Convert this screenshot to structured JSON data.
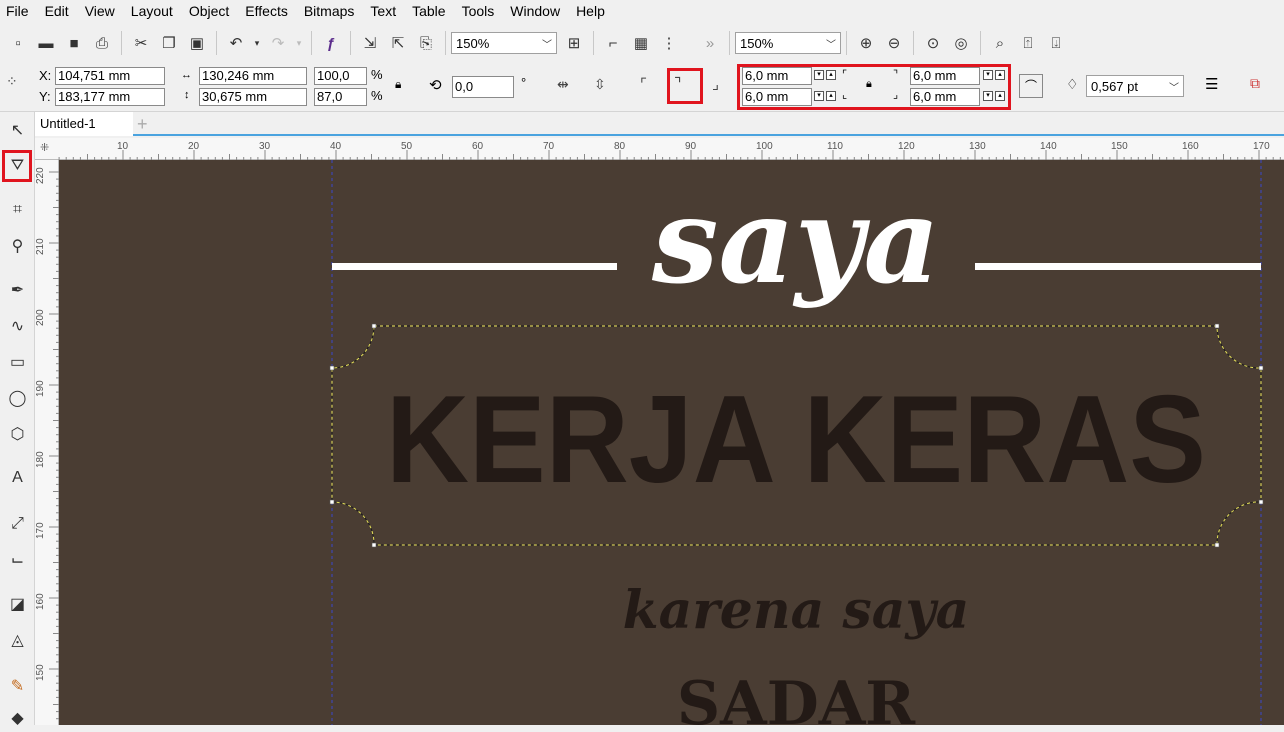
{
  "menu": [
    "File",
    "Edit",
    "View",
    "Layout",
    "Object",
    "Effects",
    "Bitmaps",
    "Text",
    "Table",
    "Tools",
    "Window",
    "Help"
  ],
  "toolbar": {
    "zoom_level_1": "150%",
    "zoom_level_2": "150%",
    "more": "»"
  },
  "props": {
    "x_label": "X:",
    "x_value": "104,751 mm",
    "y_label": "Y:",
    "y_value": "183,177 mm",
    "width_value": "130,246 mm",
    "height_value": "30,675 mm",
    "scale_x": "100,0",
    "scale_y": "87,0",
    "percent": "%",
    "rotation": "0,0",
    "degree": "°",
    "corner_tl": "6,0 mm",
    "corner_bl": "6,0 mm",
    "corner_tr": "6,0 mm",
    "corner_br": "6,0 mm",
    "outline_width": "0,567 pt"
  },
  "document": {
    "tab_title": "Untitled-1"
  },
  "ruler": {
    "h_ticks": [
      "10",
      "20",
      "30",
      "40",
      "50",
      "60",
      "70",
      "80",
      "90",
      "100",
      "110",
      "120",
      "130",
      "140",
      "150",
      "160",
      "170"
    ],
    "v_ticks": [
      "220",
      "210",
      "200",
      "190",
      "180",
      "170",
      "160",
      "150"
    ]
  },
  "artwork": {
    "word_script_top": "saya",
    "headline": "KERJA KERAS",
    "script_sub": "karena saya",
    "bold_bottom": "SADAR"
  },
  "colors": {
    "canvas_bg": "#4a3d33",
    "headline": "#231a16",
    "highlight": "#e0141e",
    "tab_accent": "#4aa3df"
  }
}
